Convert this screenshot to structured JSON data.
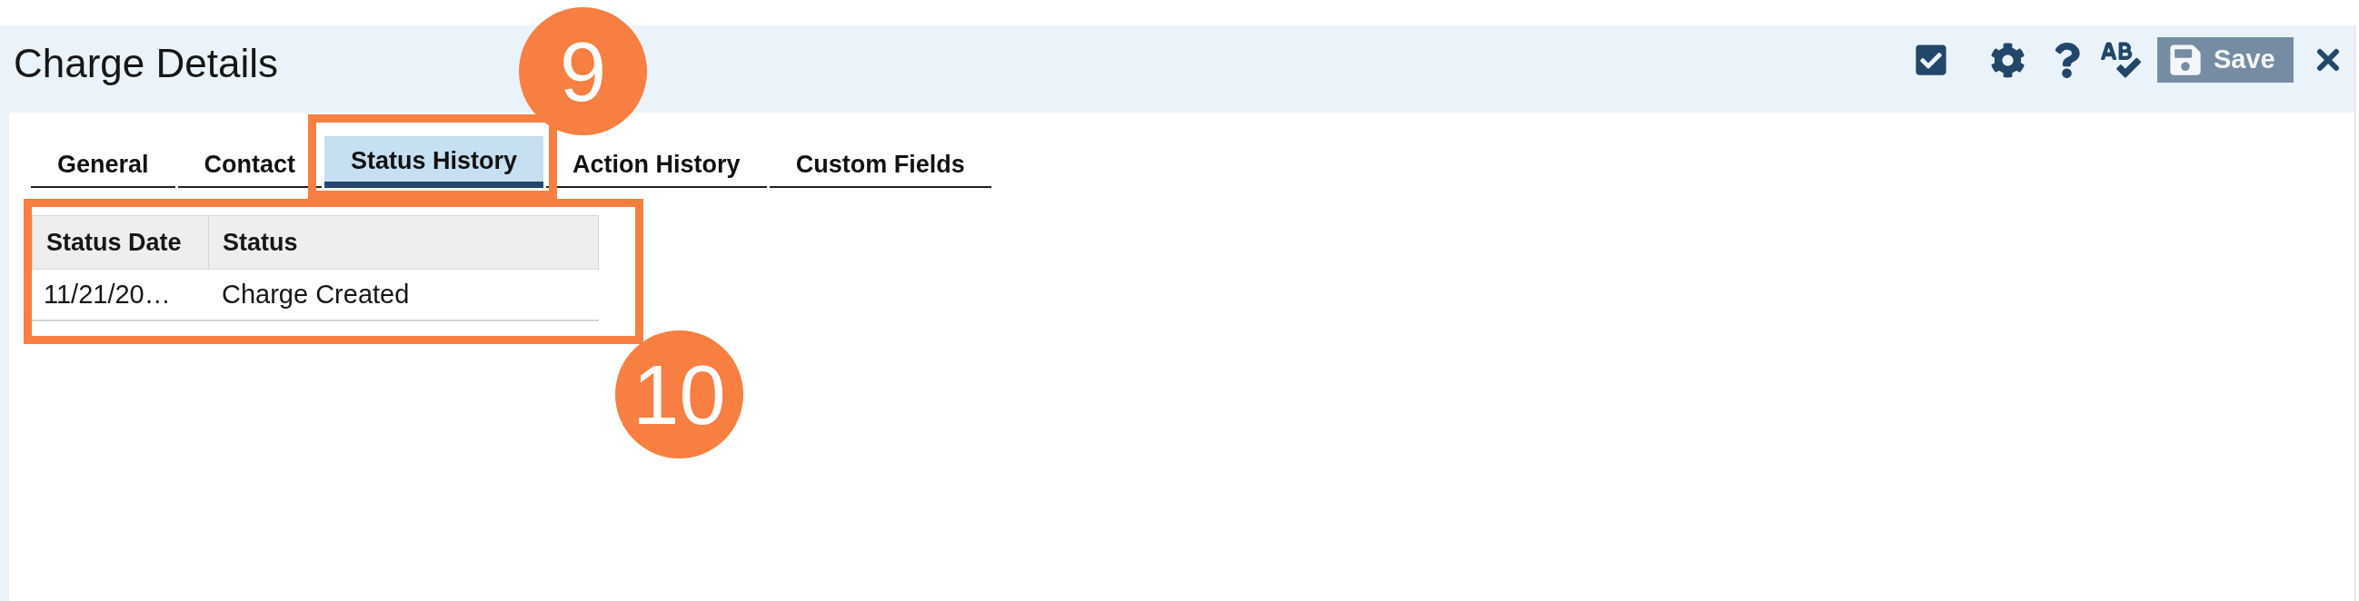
{
  "window": {
    "title": "Charge Details"
  },
  "save_button": {
    "label": "Save",
    "disabled": true
  },
  "tabs": [
    {
      "label": "General",
      "selected": false
    },
    {
      "label": "Contact",
      "selected": false
    },
    {
      "label": "Status History",
      "selected": true
    },
    {
      "label": "Action History",
      "selected": false
    },
    {
      "label": "Custom Fields",
      "selected": false
    }
  ],
  "table": {
    "columns": [
      "Status Date",
      "Status"
    ],
    "rows": [
      [
        "11/21/20…",
        "Charge Created"
      ]
    ]
  },
  "annotations": [
    {
      "label": "9"
    },
    {
      "label": "10"
    }
  ]
}
